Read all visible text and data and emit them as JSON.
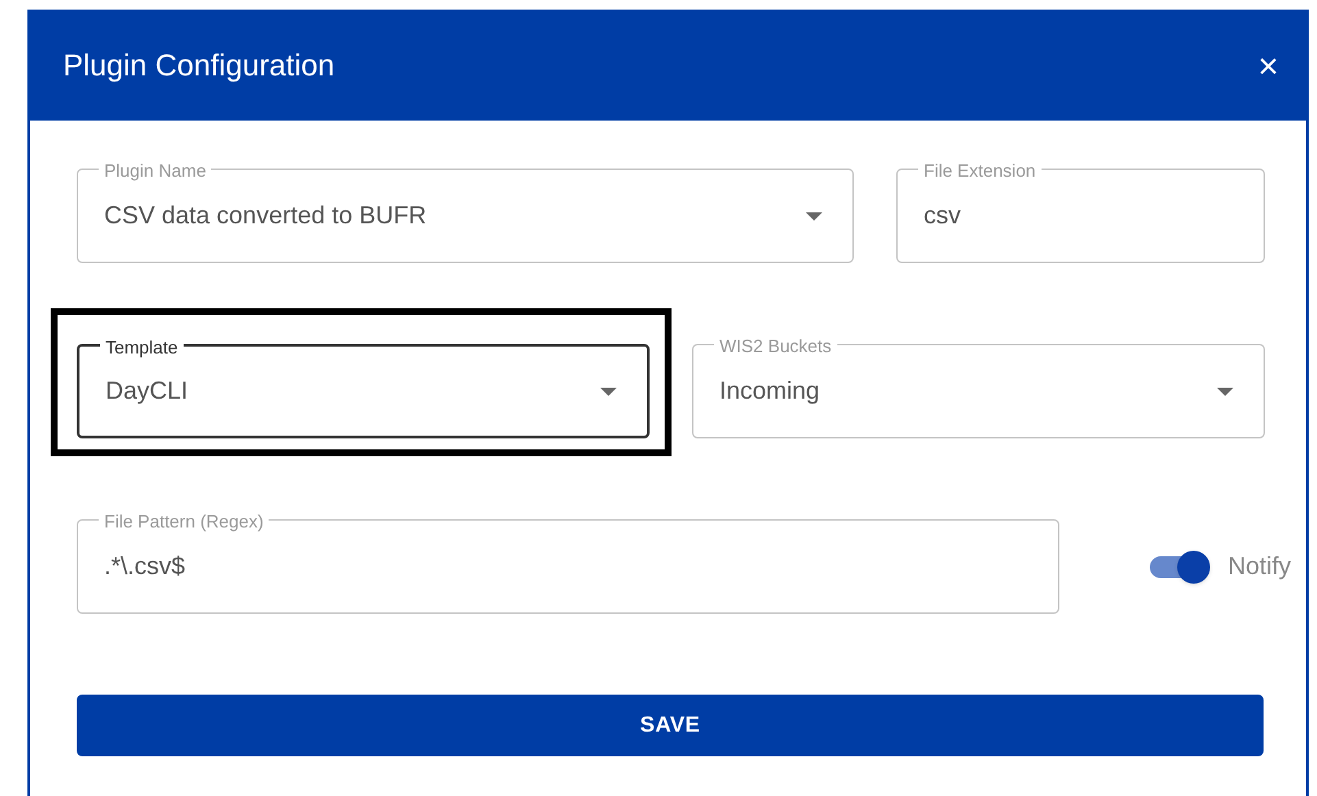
{
  "dialog": {
    "title": "Plugin Configuration",
    "close": "×"
  },
  "rows": [
    [
      {
        "kind": "select",
        "label": "Plugin Name",
        "value": "CSV data converted to BUFR",
        "highlighted": false
      },
      {
        "kind": "text",
        "label": "File Extension",
        "value": "csv",
        "highlighted": false
      }
    ],
    [
      {
        "kind": "select",
        "label": "Template",
        "value": "DayCLI",
        "highlighted": true
      },
      {
        "kind": "select",
        "label": "WIS2 Buckets",
        "value": "Incoming",
        "highlighted": false
      }
    ],
    [
      {
        "kind": "text",
        "label": "File Pattern (Regex)",
        "value": ".*\\.csv$",
        "highlighted": false
      },
      {
        "kind": "switch",
        "label": "Notify",
        "on": true
      }
    ]
  ],
  "save_button": "SAVE"
}
